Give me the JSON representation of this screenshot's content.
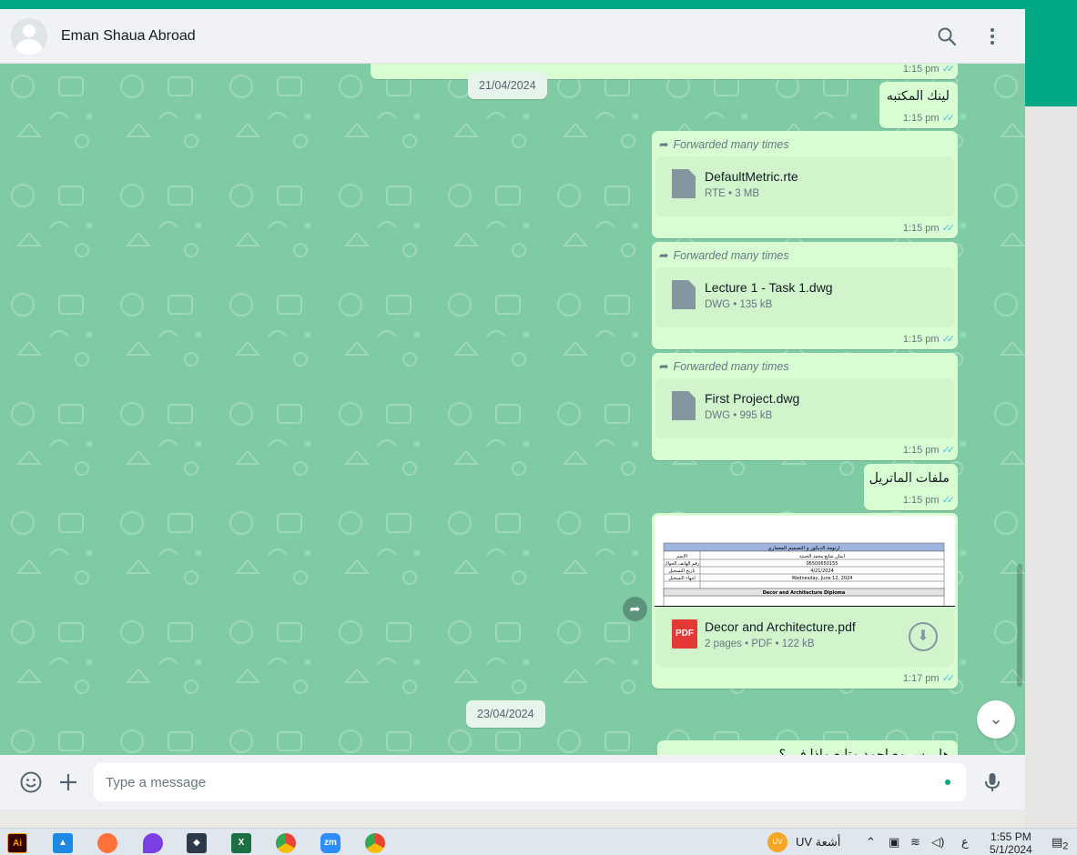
{
  "colors": {
    "accent": "#00a884",
    "bubble_out": "#d9fdd3",
    "wallpaper": "#7fcca4",
    "tick_read": "#53bdeb"
  },
  "header": {
    "contact_name": "Eman Shaua Abroad"
  },
  "messages": {
    "partial_top_time": "1:15 pm",
    "date_1": "21/04/2024",
    "m1_text": "لينك المكتبه",
    "m1_time": "1:15 pm",
    "forwarded_label": "Forwarded many times",
    "files": [
      {
        "name": "DefaultMetric.rte",
        "meta": "RTE • 3 MB",
        "time": "1:15 pm"
      },
      {
        "name": "Lecture 1 - Task 1.dwg",
        "meta": "DWG • 135 kB",
        "time": "1:15 pm"
      },
      {
        "name": "First Project.dwg",
        "meta": "DWG • 995 kB",
        "time": "1:15 pm"
      }
    ],
    "m2_text": "ملفات الماتريل",
    "m2_time": "1:15 pm",
    "pdf": {
      "preview_title": "ارتومة الديكور و التصميم المعماري",
      "preview_rows": [
        [
          "ايمان شايع محمد الخبيثة",
          "الاسم"
        ],
        [
          "06500650155",
          "رقم الهاتف الجوال"
        ],
        [
          "4/21/2024",
          "تاريخ التسجيل"
        ],
        [
          "Wednesday, June 12, 2024",
          "انتهاء التسجيل"
        ]
      ],
      "preview_subtitle": "Decor and Architecture Diploma",
      "icon_label": "PDF",
      "name": "Decor and Architecture.pdf",
      "meta": "2 pages • PDF • 122 kB",
      "time": "1:17 pm"
    },
    "date_2": "23/04/2024",
    "m3_partial_text": "هل بس مع احمد متابع ماذا في ؟"
  },
  "composer": {
    "placeholder": "Type a message"
  },
  "taskbar": {
    "apps": [
      "Ai",
      "zm"
    ],
    "weather": "أشعة UV",
    "weather_badge": "UV",
    "lang": "ع",
    "time": "1:55 PM",
    "date": "5/1/2024",
    "notif_count": "2"
  }
}
